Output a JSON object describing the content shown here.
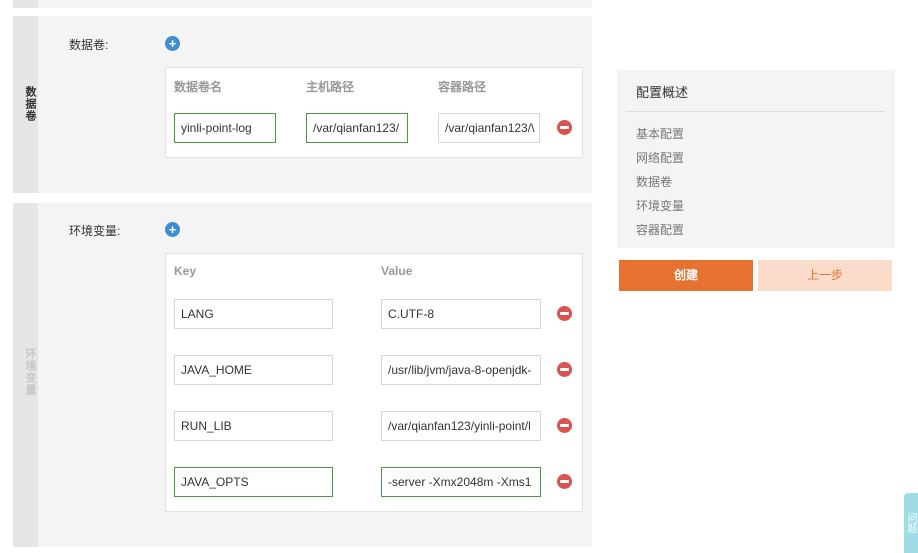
{
  "volumes": {
    "side_title": "数据卷",
    "label": "数据卷:",
    "columns": [
      "数据卷名",
      "主机路径",
      "容器路径"
    ],
    "row": {
      "name": "yinli-point-log",
      "host_path": "/var/qianfan123/",
      "container_path": "/var/qianfan123/\\"
    }
  },
  "env": {
    "side_title": "环境变量",
    "label": "环境变量:",
    "columns": [
      "Key",
      "Value"
    ],
    "rows": [
      {
        "key": "LANG",
        "value": "C.UTF-8"
      },
      {
        "key": "JAVA_HOME",
        "value": "/usr/lib/jvm/java-8-openjdk-"
      },
      {
        "key": "RUN_LIB",
        "value": "/var/qianfan123/yinli-point/l"
      },
      {
        "key": "JAVA_OPTS",
        "value": "-server -Xmx2048m -Xms1"
      }
    ]
  },
  "summary": {
    "title": "配置概述",
    "items": [
      "基本配置",
      "网络配置",
      "数据卷",
      "环境变量",
      "容器配置"
    ]
  },
  "buttons": {
    "create": "创建",
    "prev": "上一步"
  },
  "side_tab": {
    "label": "问题"
  },
  "colors": {
    "accent": "#e67130",
    "add": "#3d8fd1",
    "remove": "#d9534f",
    "active_border": "#4a9a3f"
  }
}
